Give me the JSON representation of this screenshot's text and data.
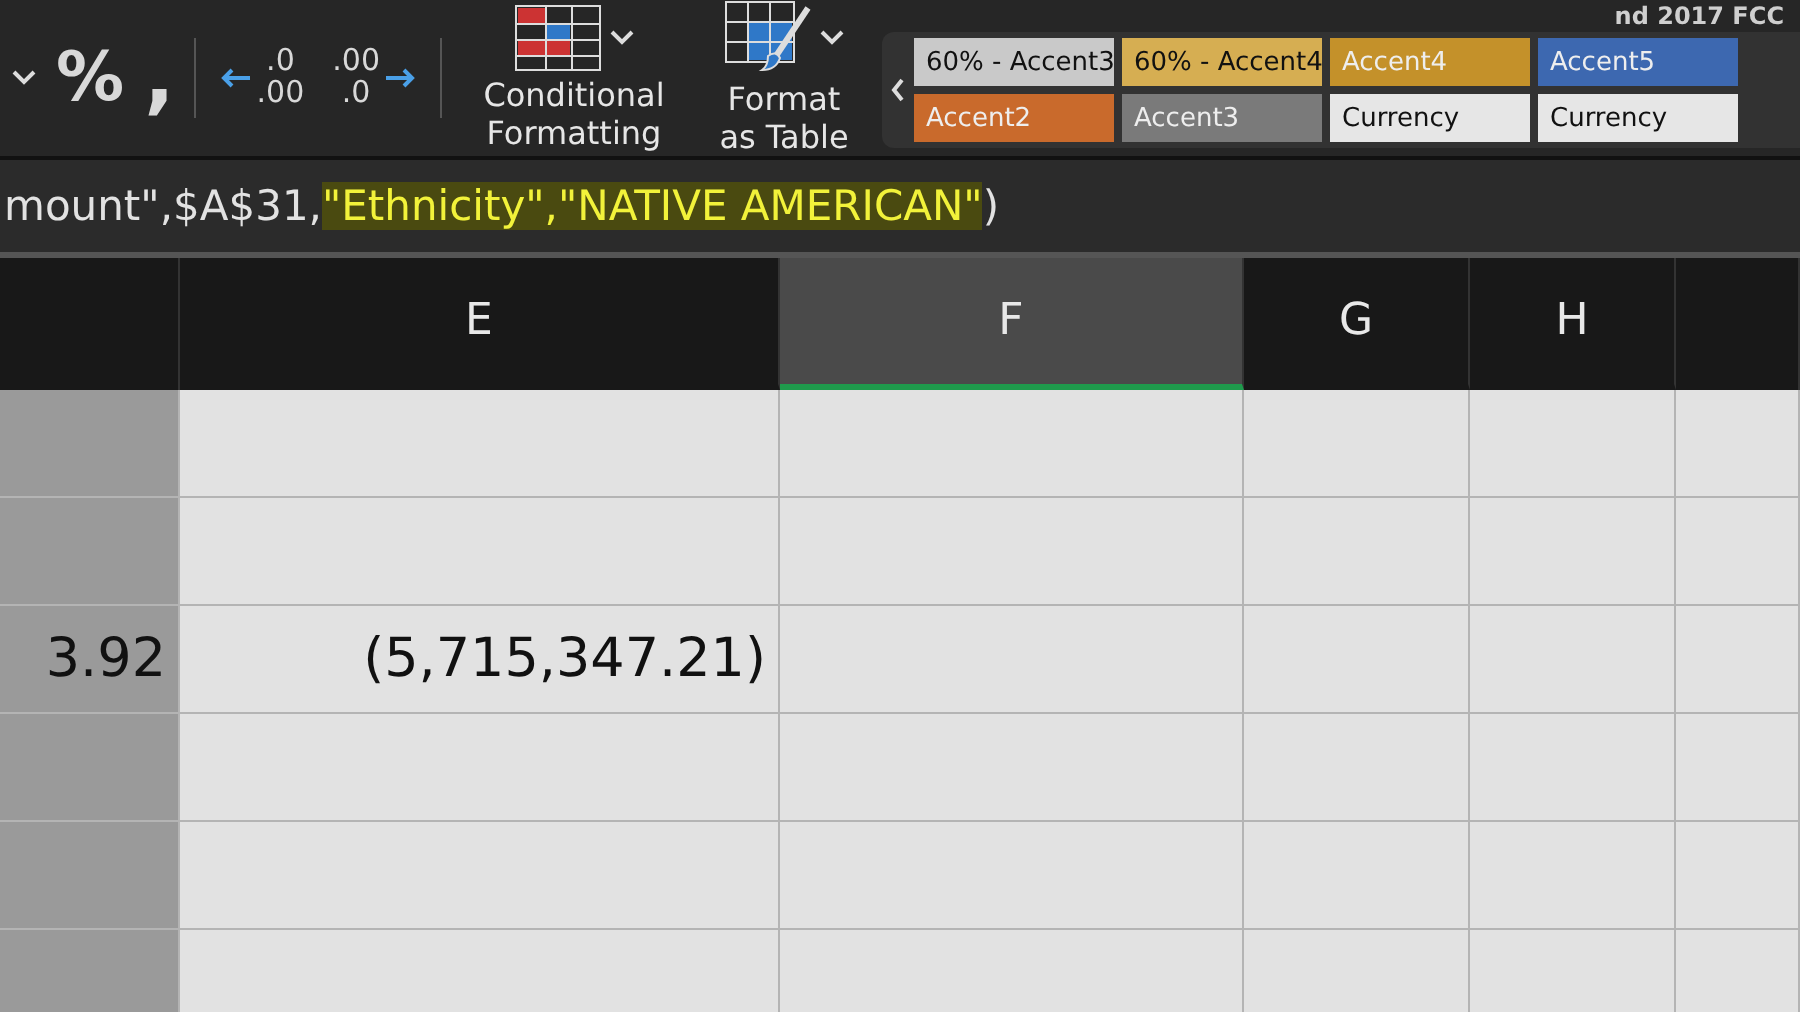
{
  "window": {
    "title": "nd 2017 FCC"
  },
  "ribbon": {
    "number_format": {
      "percent": "%",
      "comma": ","
    },
    "decimal_buttons": [
      {
        "kind": "decrease",
        "top": ".0",
        "bottom": ".00"
      },
      {
        "kind": "increase",
        "top": ".00",
        "bottom": ".0"
      }
    ],
    "format_buttons": [
      {
        "kind": "conditional",
        "label": "Conditional Formatting"
      },
      {
        "kind": "table",
        "label": "Format as Table"
      }
    ],
    "styles": [
      [
        {
          "label": "60% - Accent3",
          "color": "#c9c9c9"
        },
        {
          "label": "60% - Accent4",
          "color": "#d6ae52"
        },
        {
          "label": "Accent4",
          "color": "#c4912a"
        },
        {
          "label": "Accent5",
          "color": "#3d68b0"
        }
      ],
      [
        {
          "label": "Accent2",
          "color": "#c96a2c"
        },
        {
          "label": "Accent3",
          "color": "#7a7a7a"
        },
        {
          "label": "Currency",
          "color": "#e6e6e6"
        },
        {
          "label": "Currency",
          "color": "#e6e6e6"
        }
      ]
    ]
  },
  "formula_bar": {
    "parts": [
      {
        "text": "mount\",$A$31,",
        "highlighted": false
      },
      {
        "text": "\"Ethnicity\",\"NATIVE AMERICAN\"",
        "highlighted": true
      },
      {
        "text": ")",
        "highlighted": false
      }
    ]
  },
  "sheet": {
    "columns": [
      {
        "label": "E",
        "selected": false
      },
      {
        "label": "F",
        "selected": true
      },
      {
        "label": "G",
        "selected": false
      },
      {
        "label": "H",
        "selected": false
      }
    ],
    "rows": [
      {
        "kind": "empty"
      },
      {
        "kind": "empty"
      },
      {
        "kind": "values",
        "column_d": "3.92",
        "column_e": "(5,715,347.21)"
      },
      {
        "kind": "empty"
      },
      {
        "kind": "empty"
      },
      {
        "kind": "empty"
      }
    ]
  }
}
